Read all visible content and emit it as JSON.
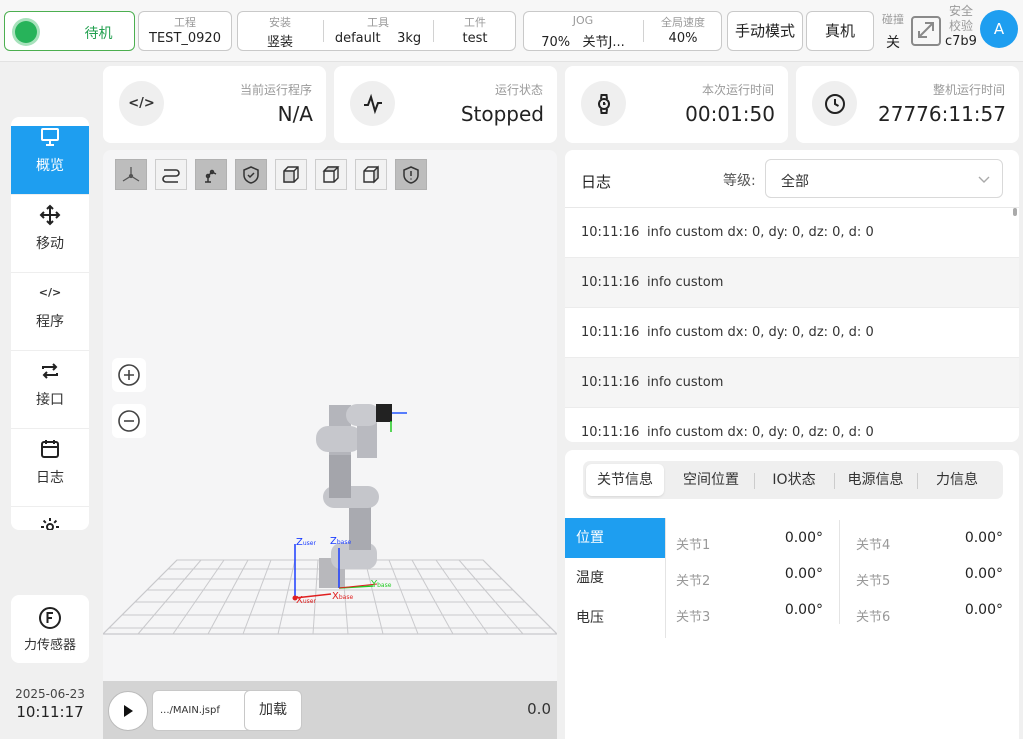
{
  "topbar": {
    "status": "待机",
    "project": {
      "label": "工程",
      "value": "TEST_0920"
    },
    "install": {
      "label": "安装",
      "value": "竖装"
    },
    "tool": {
      "label": "工具",
      "value": "default",
      "payload": "3kg"
    },
    "workpiece": {
      "label": "工件",
      "value": "test"
    },
    "jog": {
      "label": "JOG",
      "value": "70%",
      "mode": "关节J..."
    },
    "global_speed": {
      "label": "全局速度",
      "value": "40%"
    },
    "manual_mode": "手动模式",
    "real_robot": "真机",
    "collision": {
      "label": "碰撞",
      "value": "关"
    },
    "safety": {
      "label1": "安全",
      "label2": "校验",
      "value": "c7b9"
    },
    "avatar": "A",
    "colors": {
      "status_green": "#27b35a",
      "accent_blue": "#1e9ef0"
    }
  },
  "sidenav": {
    "items": [
      {
        "label": "概览",
        "icon": "monitor-icon",
        "active": true
      },
      {
        "label": "移动",
        "icon": "move-icon"
      },
      {
        "label": "程序",
        "icon": "code-icon"
      },
      {
        "label": "接口",
        "icon": "repeat-icon"
      },
      {
        "label": "日志",
        "icon": "calendar-icon"
      },
      {
        "label": "设置",
        "icon": "gear-icon"
      }
    ],
    "force_sensor": {
      "label": "力传感器",
      "icon": "f-circle-icon"
    },
    "date": "2025-06-23",
    "time": "10:11:17"
  },
  "stats": [
    {
      "label": "当前运行程序",
      "value": "N/A",
      "icon": "code-icon"
    },
    {
      "label": "运行状态",
      "value": "Stopped",
      "icon": "pulse-icon"
    },
    {
      "label": "本次运行时间",
      "value": "00:01:50",
      "icon": "watch-icon"
    },
    {
      "label": "整机运行时间",
      "value": "27776:11:57",
      "icon": "clock-icon"
    }
  ],
  "viewport": {
    "axis_labels": {
      "z_user": "Z",
      "z_user_sub": "user",
      "z_base": "Z",
      "z_base_sub": "base",
      "x_user": "X",
      "x_user_sub": "user",
      "x_base": "X",
      "x_base_sub": "base",
      "y_base": "Y",
      "y_base_sub": "base"
    },
    "program_file": ".../MAIN.jspf",
    "load_button": "加载",
    "speed_value": "0.0"
  },
  "log": {
    "title": "日志",
    "level_label": "等级:",
    "level_value": "全部",
    "rows": [
      {
        "time": "10:11:16",
        "message": "info custom dx: 0, dy: 0, dz: 0, d: 0"
      },
      {
        "time": "10:11:16",
        "message": "info custom"
      },
      {
        "time": "10:11:16",
        "message": "info custom dx: 0, dy: 0, dz: 0, d: 0"
      },
      {
        "time": "10:11:16",
        "message": "info custom"
      },
      {
        "time": "10:11:16",
        "message": "info custom dx: 0, dy: 0, dz: 0, d: 0"
      }
    ]
  },
  "info": {
    "tabs": [
      "关节信息",
      "空间位置",
      "IO状态",
      "电源信息",
      "力信息"
    ],
    "subnav": [
      "位置",
      "温度",
      "电压"
    ],
    "joints": [
      {
        "name": "关节1",
        "value": "0.00°"
      },
      {
        "name": "关节2",
        "value": "0.00°"
      },
      {
        "name": "关节3",
        "value": "0.00°"
      },
      {
        "name": "关节4",
        "value": "0.00°"
      },
      {
        "name": "关节5",
        "value": "0.00°"
      },
      {
        "name": "关节6",
        "value": "0.00°"
      }
    ]
  }
}
